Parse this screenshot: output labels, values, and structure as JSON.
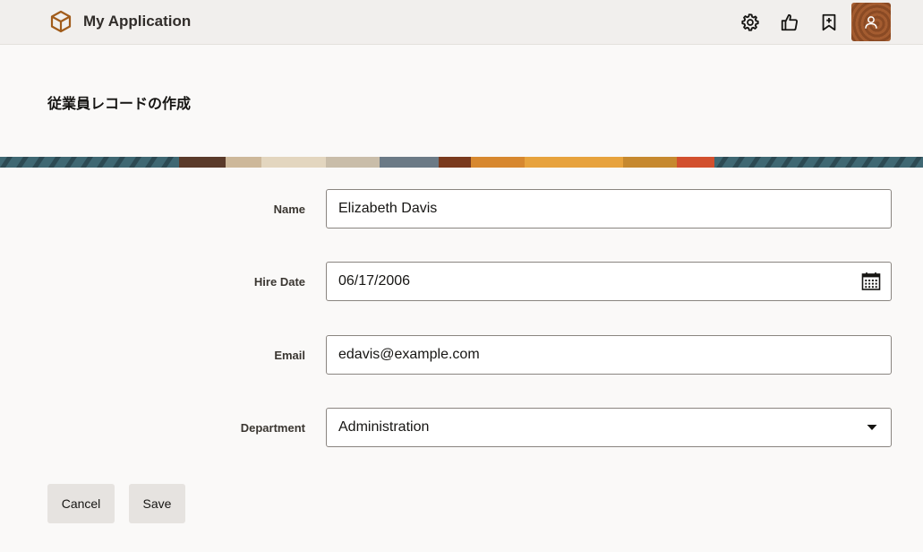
{
  "header": {
    "app_title": "My Application",
    "logo_icon": "cube-icon",
    "actions": [
      {
        "name": "settings",
        "icon": "gear-icon"
      },
      {
        "name": "feedback",
        "icon": "thumbs-up-icon"
      },
      {
        "name": "bookmark",
        "icon": "bookmark-add-icon"
      },
      {
        "name": "user",
        "icon": "user-icon"
      }
    ]
  },
  "page": {
    "title": "従業員レコードの作成"
  },
  "form": {
    "name": {
      "label": "Name",
      "value": "Elizabeth Davis"
    },
    "hire_date": {
      "label": "Hire Date",
      "value": "06/17/2006",
      "icon": "calendar-icon"
    },
    "email": {
      "label": "Email",
      "value": "edavis@example.com"
    },
    "department": {
      "label": "Department",
      "value": "Administration",
      "icon": "caret-down-icon"
    }
  },
  "buttons": {
    "cancel": "Cancel",
    "save": "Save"
  },
  "colors": {
    "header_bg": "#f1efed",
    "page_bg": "#faf9f8",
    "accent": "#8a4a24",
    "button_bg": "#e6e3e0"
  }
}
